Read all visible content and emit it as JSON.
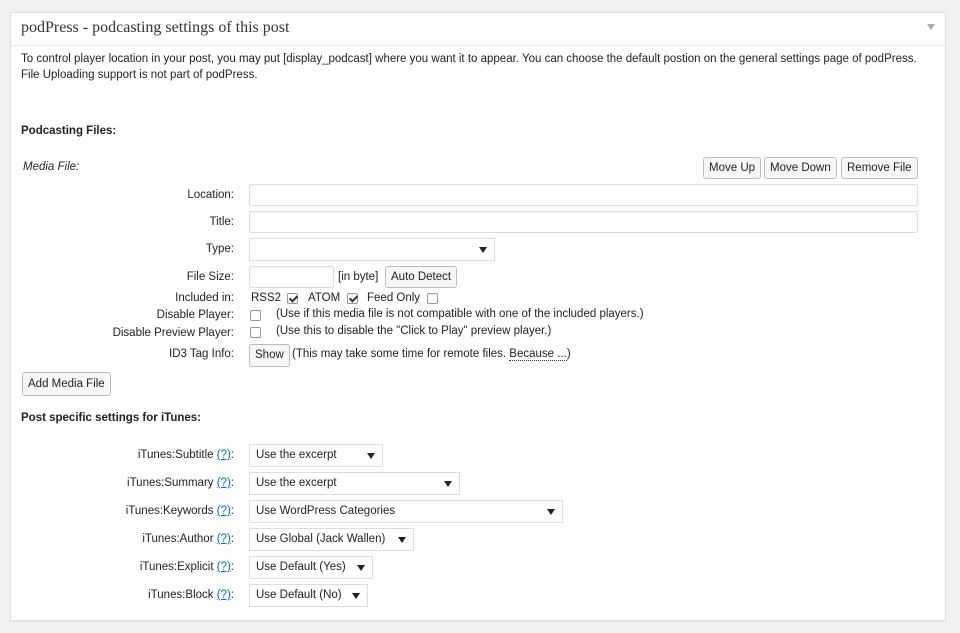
{
  "panel": {
    "title": "podPress - podcasting settings of this post",
    "intro_line1": "To control player location in your post, you may put [display_podcast] where you want it to appear. You can choose the default postion on the general settings page of podPress.",
    "intro_line2": "File Uploading support is not part of podPress."
  },
  "files": {
    "heading": "Podcasting Files:",
    "media_file_label": "Media File:",
    "move_up": "Move Up",
    "move_down": "Move Down",
    "remove_file": "Remove File",
    "location_label": "Location:",
    "location_value": "",
    "title_label": "Title:",
    "title_value": "",
    "type_label": "Type:",
    "type_value": "",
    "filesize_label": "File Size:",
    "filesize_value": "",
    "in_byte": "[in byte]",
    "auto_detect": "Auto Detect",
    "included_label": "Included in:",
    "rss2": "RSS2",
    "rss2_checked": true,
    "atom": "ATOM",
    "atom_checked": true,
    "feed_only": "Feed Only",
    "feed_only_checked": false,
    "disable_player_label": "Disable Player:",
    "disable_player_note": "(Use if this media file is not compatible with one of the included players.)",
    "disable_preview_label": "Disable Preview Player:",
    "disable_preview_note": "(Use this to disable the \"Click to Play\" preview player.)",
    "id3_label": "ID3 Tag Info:",
    "show": "Show",
    "id3_note_a": "(This may take some time for remote files. ",
    "id3_note_link": "Because ...",
    "id3_note_b": ")",
    "add_media": "Add Media File"
  },
  "itunes": {
    "heading": "Post specific settings for iTunes:",
    "help": "(?)",
    "subtitle_label": "iTunes:Subtitle",
    "subtitle_value": "Use the excerpt",
    "summary_label": "iTunes:Summary",
    "summary_value": "Use the excerpt",
    "keywords_label": "iTunes:Keywords",
    "keywords_value": "Use WordPress Categories",
    "author_label": "iTunes:Author",
    "author_value": "Use Global (Jack Wallen)",
    "explicit_label": "iTunes:Explicit",
    "explicit_value": "Use Default (Yes)",
    "block_label": "iTunes:Block",
    "block_value": "Use Default (No)",
    "colon": ":"
  }
}
